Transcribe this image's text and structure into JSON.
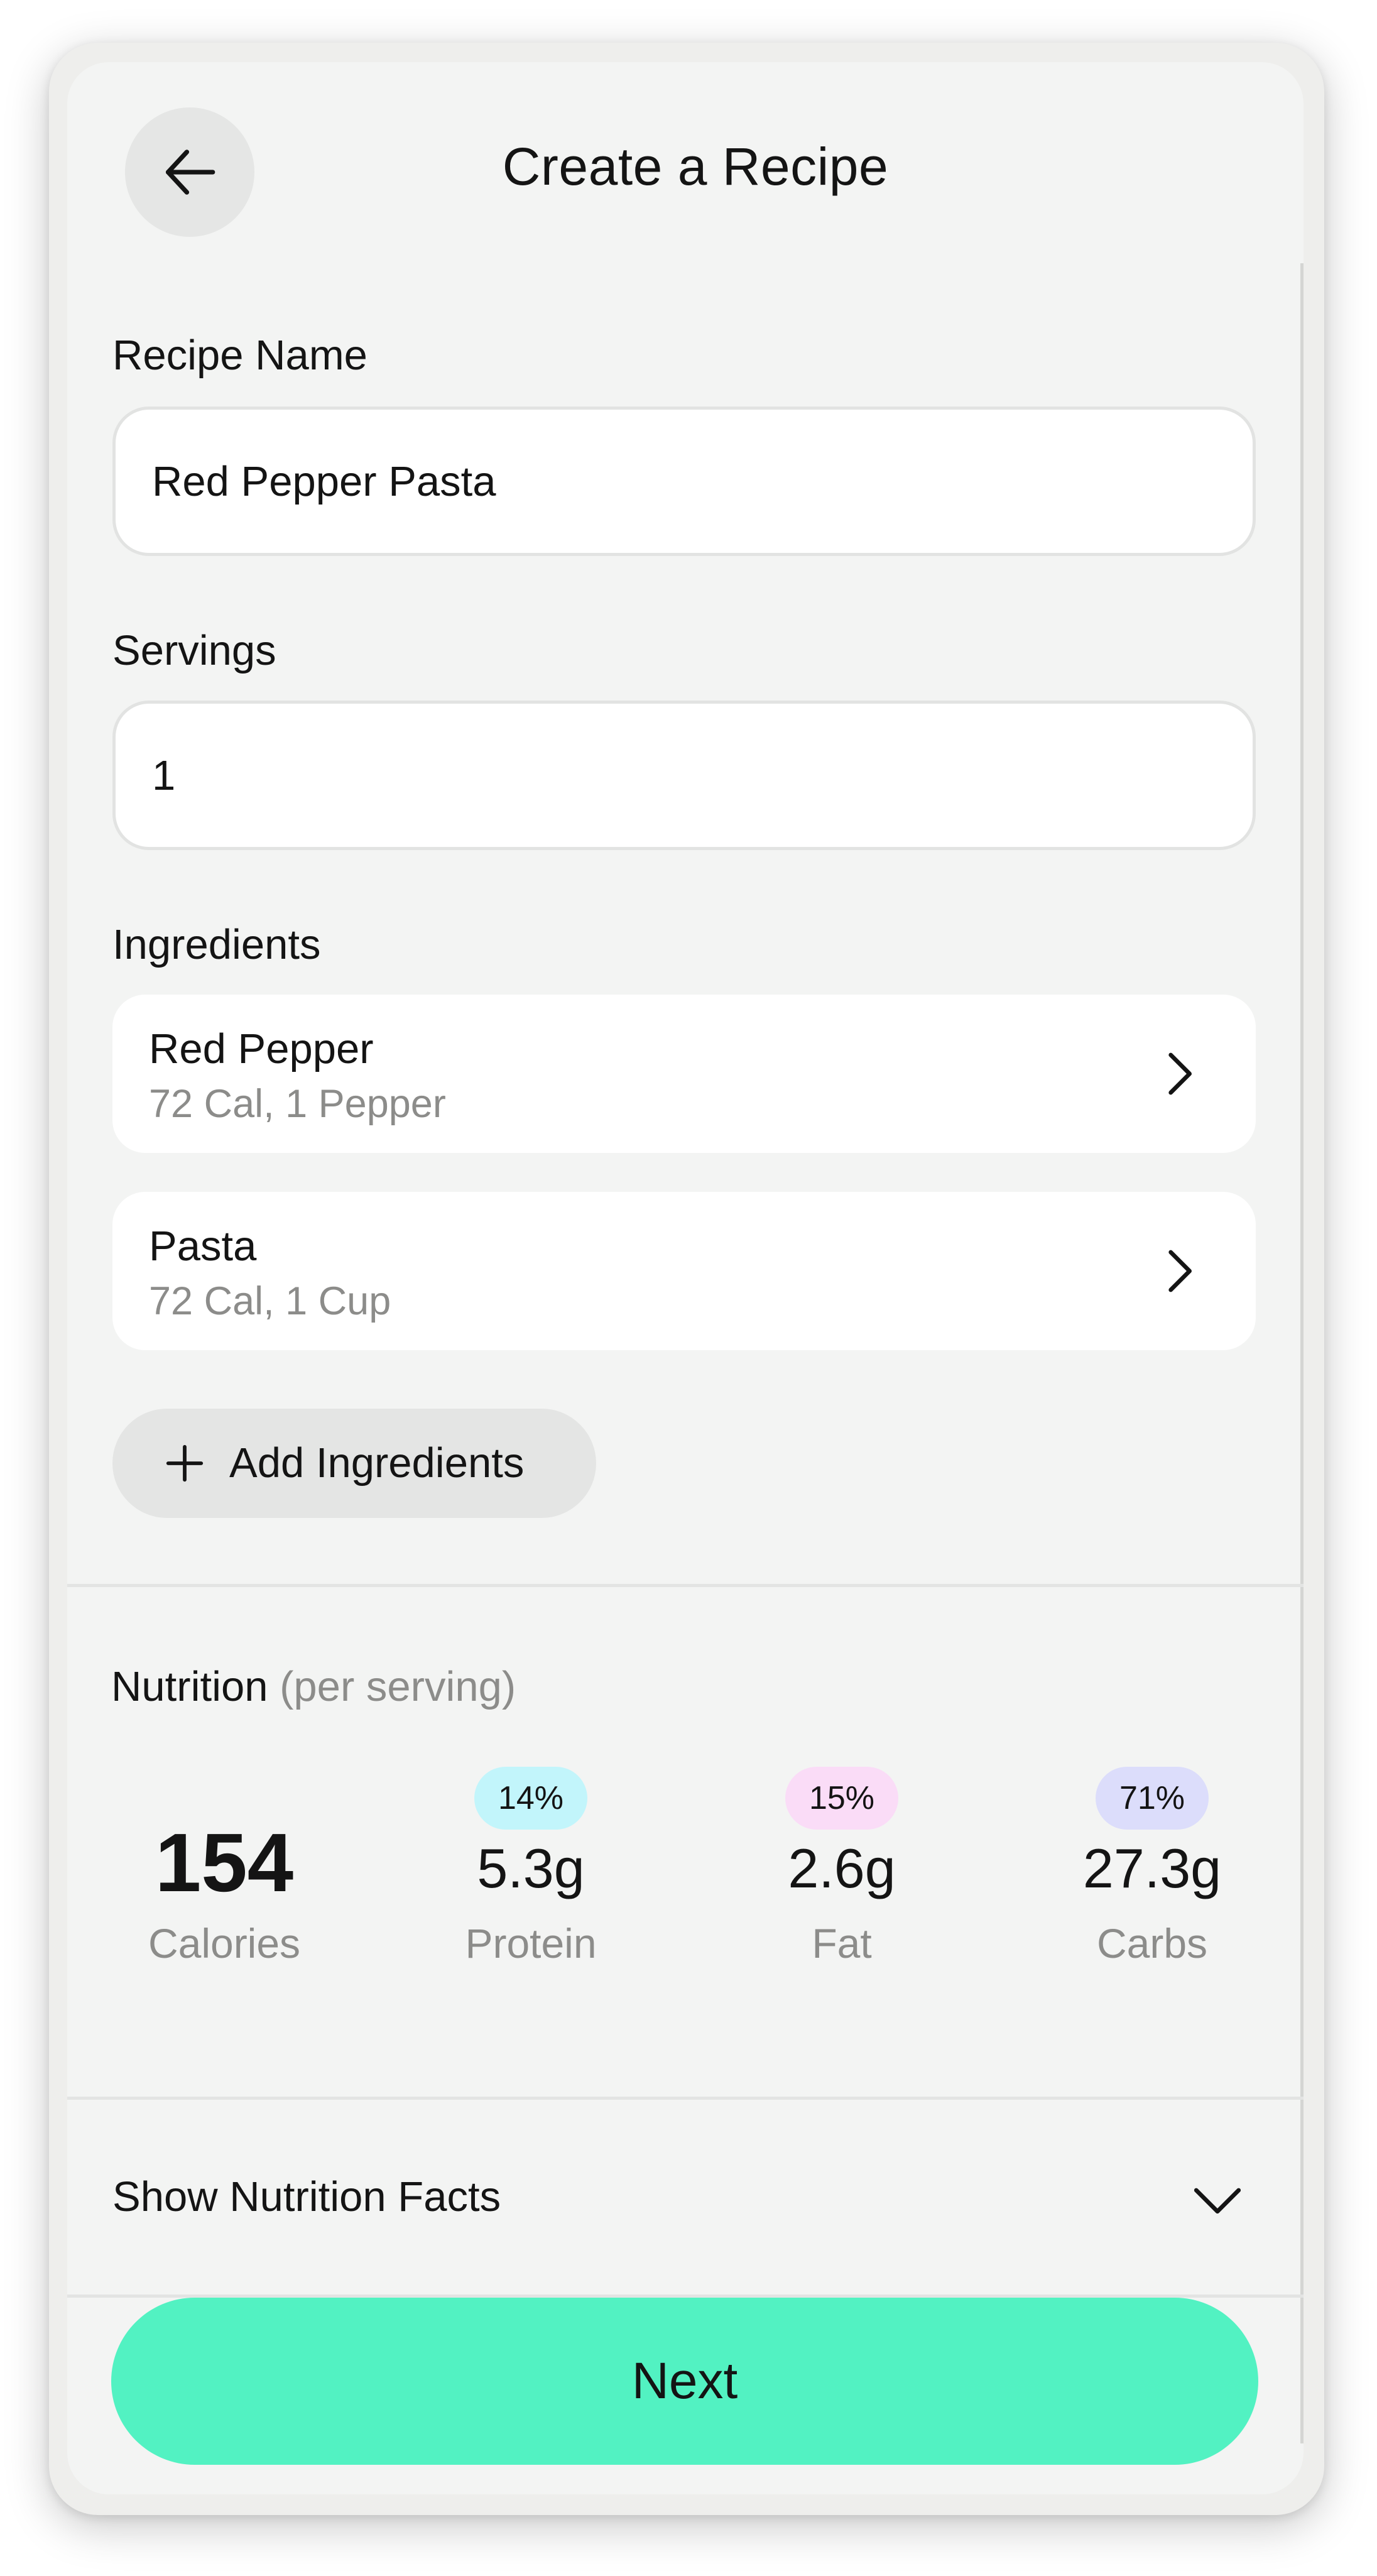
{
  "header": {
    "title": "Create a Recipe",
    "back_icon": "arrow-left-icon"
  },
  "form": {
    "recipe_name_label": "Recipe Name",
    "recipe_name_value": "Red Pepper Pasta",
    "servings_label": "Servings",
    "servings_value": "1"
  },
  "ingredients": {
    "label": "Ingredients",
    "items": [
      {
        "name": "Red Pepper",
        "detail": "72 Cal, 1 Pepper"
      },
      {
        "name": "Pasta",
        "detail": "72 Cal, 1 Cup"
      }
    ],
    "add_label": "Add Ingredients"
  },
  "nutrition": {
    "heading": "Nutrition",
    "subheading": "(per serving)",
    "calories": {
      "value": "154",
      "label": "Calories"
    },
    "macros": [
      {
        "percent": "14%",
        "value": "5.3g",
        "label": "Protein",
        "badge_color": "#c2f5fb"
      },
      {
        "percent": "15%",
        "value": "2.6g",
        "label": "Fat",
        "badge_color": "#fadcf7"
      },
      {
        "percent": "71%",
        "value": "27.3g",
        "label": "Carbs",
        "badge_color": "#dcddfb"
      }
    ],
    "show_facts_label": "Show Nutrition Facts"
  },
  "actions": {
    "next_label": "Next"
  },
  "colors": {
    "accent": "#52f2c2",
    "background": "#f3f4f3",
    "muted_text": "#8c8c8a"
  }
}
